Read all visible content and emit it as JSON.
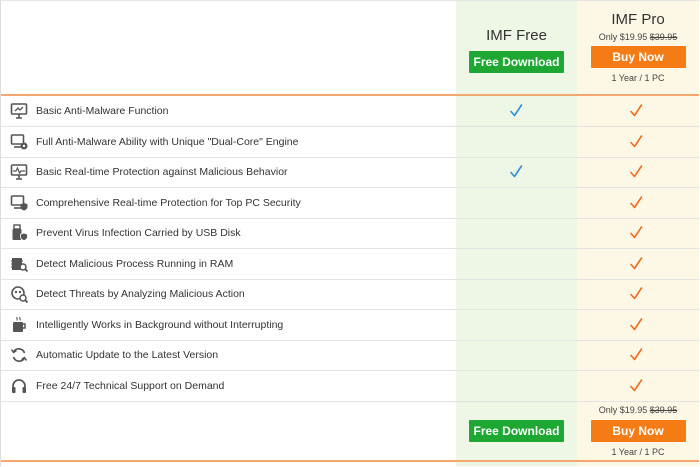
{
  "plans": {
    "free": {
      "title": "IMF Free",
      "button": "Free Download"
    },
    "pro": {
      "title": "IMF Pro",
      "price_prefix": "Only $19.95",
      "old_price": "$39.95",
      "button": "Buy Now",
      "license": "1 Year / 1 PC"
    }
  },
  "features": [
    {
      "label": "Basic Anti-Malware Function",
      "icon": "monitor-shield-icon",
      "free": true,
      "pro": true
    },
    {
      "label": "Full Anti-Malware Ability with Unique \"Dual-Core\" Engine",
      "icon": "monitor-gear-icon",
      "free": false,
      "pro": true
    },
    {
      "label": "Basic Real-time Protection against Malicious Behavior",
      "icon": "monitor-pulse-icon",
      "free": true,
      "pro": true
    },
    {
      "label": "Comprehensive Real-time Protection for Top PC Security",
      "icon": "monitor-check-icon",
      "free": false,
      "pro": true
    },
    {
      "label": "Prevent Virus Infection Carried by USB Disk",
      "icon": "usb-shield-icon",
      "free": false,
      "pro": true
    },
    {
      "label": "Detect Malicious Process Running in RAM",
      "icon": "ram-search-icon",
      "free": false,
      "pro": true
    },
    {
      "label": "Detect Threats by Analyzing Malicious Action",
      "icon": "bug-search-icon",
      "free": false,
      "pro": true
    },
    {
      "label": "Intelligently Works in Background without Interrupting",
      "icon": "coffee-cup-icon",
      "free": false,
      "pro": true
    },
    {
      "label": "Automatic Update to the Latest Version",
      "icon": "refresh-icon",
      "free": false,
      "pro": true
    },
    {
      "label": "Free 24/7 Technical Support on Demand",
      "icon": "headset-icon",
      "free": false,
      "pro": true
    }
  ],
  "colors": {
    "check_free": "#2f8fd8",
    "check_pro": "#f26b1d",
    "button_green": "#1ea733",
    "button_orange": "#f57c14"
  }
}
